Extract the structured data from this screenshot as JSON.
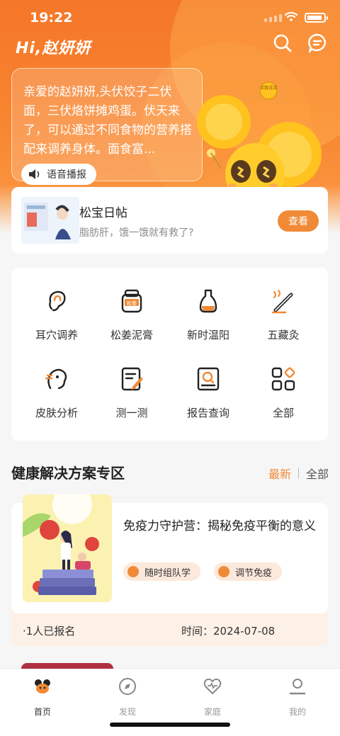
{
  "status": {
    "time": "19:22"
  },
  "header": {
    "greeting": "Hi,赵妍妍"
  },
  "bubble": {
    "text": "亲爱的赵妍妍,头伏饺子二伏面，三伏烙饼摊鸡蛋。伏天来了，可以通过不同食物的营养搭配来调养身体。面食富...",
    "voice_label": "语音播报",
    "mascot_sign": "点我试试"
  },
  "diary": {
    "title": "松宝日帖",
    "subtitle": "脂肪肝，饿一饿就有救了?",
    "view_label": "查看"
  },
  "services": [
    {
      "label": "耳穴调养",
      "icon": "ear-icon"
    },
    {
      "label": "松姜泥膏",
      "icon": "ginger-paste-icon",
      "badge": "松姜"
    },
    {
      "label": "新时温阳",
      "icon": "moxa-cup-icon"
    },
    {
      "label": "五藏灸",
      "icon": "moxibustion-stick-icon"
    },
    {
      "label": "皮肤分析",
      "icon": "face-analysis-icon"
    },
    {
      "label": "测一测",
      "icon": "test-edit-icon"
    },
    {
      "label": "报告查询",
      "icon": "report-search-icon"
    },
    {
      "label": "全部",
      "icon": "all-grid-icon"
    }
  ],
  "section": {
    "title": "健康解决方案专区",
    "latest": "最新",
    "all": "全部"
  },
  "program": {
    "title": "免疫力守护营：揭秘免疫平衡的意义",
    "tags": [
      "随时组队学",
      "调节免疫"
    ],
    "enrolled": "·1人已报名",
    "time_label": "时间：",
    "date": "2024-07-08"
  },
  "tabs": [
    {
      "label": "首页",
      "icon": "home-icon",
      "active": true
    },
    {
      "label": "发现",
      "icon": "compass-icon",
      "active": false
    },
    {
      "label": "家庭",
      "icon": "family-heart-icon",
      "active": false
    },
    {
      "label": "我的",
      "icon": "profile-icon",
      "active": false
    }
  ],
  "colors": {
    "accent": "#f08a37",
    "hero": "#f5762a"
  }
}
